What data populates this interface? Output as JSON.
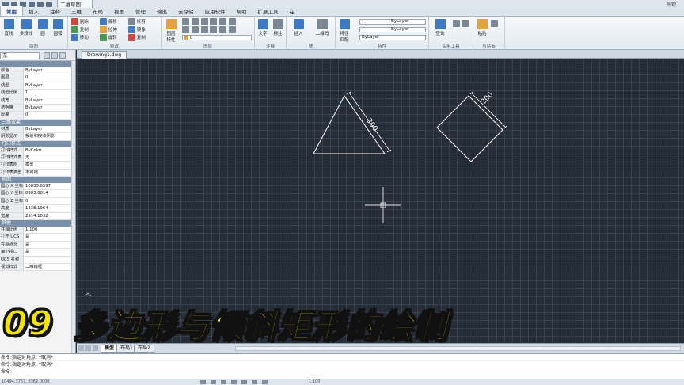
{
  "window": {
    "doc_title": "二维草图",
    "right_label": "外观"
  },
  "ribbon_tabs": [
    "常用",
    "插入",
    "注释",
    "三维",
    "布局",
    "视图",
    "管理",
    "输出",
    "云存储",
    "应用软件",
    "帮助",
    "扩展工具",
    "在"
  ],
  "ribbon": {
    "groups": [
      "绘图",
      "修改",
      "图层",
      "注释",
      "块",
      "特性",
      "实用工具",
      "剪贴板"
    ],
    "draw": {
      "line": "直线",
      "polyline": "多段线",
      "circle": "圆",
      "arc": "圆弧"
    },
    "modify": [
      "删除",
      "复制",
      "移动",
      "偏移",
      "拉伸",
      "旋转",
      "修剪",
      "镜像",
      "复制",
      "延伸"
    ],
    "layer": {
      "props": "图层\n特性",
      "current": "0"
    },
    "annot": {
      "text": "文字",
      "dim": "标注"
    },
    "block": {
      "insert": "插入",
      "create": "二维码"
    },
    "props": {
      "match": "特性\n匹配",
      "color": "ByLayer",
      "linetype": "ByLayer",
      "lineweight": "ByLayer"
    },
    "util": {
      "measure": "查询"
    },
    "clip": {
      "paste": "粘贴"
    }
  },
  "props_panel": {
    "selection": "无",
    "sections": [
      {
        "title": "",
        "rows": [
          {
            "k": "颜色",
            "v": "ByLayer"
          },
          {
            "k": "图层",
            "v": "0"
          },
          {
            "k": "线型",
            "v": "ByLayer"
          },
          {
            "k": "线型比例",
            "v": "1"
          },
          {
            "k": "线宽",
            "v": "ByLayer"
          },
          {
            "k": "透明度",
            "v": "ByLayer"
          },
          {
            "k": "厚度",
            "v": "0"
          }
        ]
      },
      {
        "title": "三维效果",
        "rows": [
          {
            "k": "材质",
            "v": "ByLayer"
          },
          {
            "k": "阴影显示",
            "v": "投射和接收阴影"
          }
        ]
      },
      {
        "title": "打印样式",
        "rows": [
          {
            "k": "打印样式",
            "v": "ByColor"
          },
          {
            "k": "打印样式表",
            "v": "无"
          },
          {
            "k": "打印表附",
            "v": "模型"
          },
          {
            "k": "打印表类型",
            "v": "不可用"
          }
        ]
      },
      {
        "title": "视图",
        "rows": [
          {
            "k": "圆心 X 坐标",
            "v": "10833.6597"
          },
          {
            "k": "圆心 Y 坐标",
            "v": "8383.6814"
          },
          {
            "k": "圆心 Z 坐标",
            "v": "0"
          },
          {
            "k": "高度",
            "v": "1338.1964"
          },
          {
            "k": "宽度",
            "v": "2914.1032"
          }
        ]
      },
      {
        "title": "其他",
        "rows": [
          {
            "k": "注释比例",
            "v": "1:100"
          },
          {
            "k": "打开 UCS",
            "v": "是"
          },
          {
            "k": "在原点显",
            "v": "是"
          },
          {
            "k": "每个视口",
            "v": "是"
          },
          {
            "k": "UCS 名称",
            "v": ""
          },
          {
            "k": "视觉样式",
            "v": "二维线框"
          }
        ]
      }
    ]
  },
  "drawing": {
    "file_tab": "Drawing1.dwg",
    "dims": {
      "triangle_side": "300",
      "square_side": "200"
    }
  },
  "layout_tabs": [
    "模型",
    "布局1",
    "布局2"
  ],
  "command_lines": [
    "命令:指定对角点: *取消*",
    "命令:指定对角点: *取消*",
    "命令:"
  ],
  "status": {
    "coords": "10494.3757, 8362.0000",
    "zoom": "1:100"
  },
  "caption": {
    "number": "09",
    "title": "多边形与倾斜矩形的绘制"
  }
}
